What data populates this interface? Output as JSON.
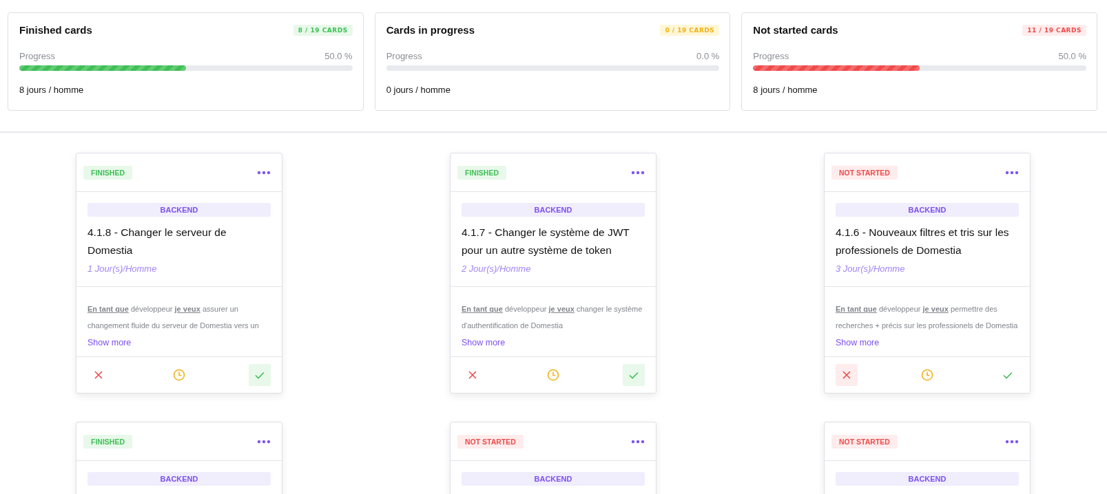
{
  "summary": [
    {
      "title": "Finished cards",
      "kind": "finished",
      "count": "8 / 19 CARDS",
      "progress_label": "Progress",
      "percent": "50.0 %",
      "level": 0.5,
      "effort": "8 jours / homme"
    },
    {
      "title": "Cards in progress",
      "kind": "in_progress",
      "count": "0 / 19 CARDS",
      "progress_label": "Progress",
      "percent": "0.0 %",
      "level": 0,
      "effort": "0 jours / homme"
    },
    {
      "title": "Not started cards",
      "kind": "not_started",
      "count": "11 / 19 CARDS",
      "progress_label": "Progress",
      "percent": "50.0 %",
      "level": 0.5,
      "effort": "8 jours / homme"
    }
  ],
  "cards": [
    {
      "kind": "finished",
      "status_label": "FINISHED",
      "tag": "BACKEND",
      "title": "4.1.8 - Changer le serveur de Domestia",
      "effort": "1 Jour(s)/Homme",
      "description": "**En tant que** développeur **je veux** assurer un changement fluide du serveur de Domestia vers un",
      "show_more": "Show more"
    },
    {
      "kind": "finished",
      "status_label": "FINISHED",
      "tag": "BACKEND",
      "title": "4.1.7 - Changer le système de JWT pour un autre système de token",
      "effort": "2 Jour(s)/Homme",
      "description": "**En tant que** développeur **je veux** changer le système d'authentification de Domestia",
      "show_more": "Show more"
    },
    {
      "kind": "not_started",
      "status_label": "NOT STARTED",
      "tag": "BACKEND",
      "title": "4.1.6 - Nouveaux filtres et tris sur les professionels de Domestia",
      "effort": "3 Jour(s)/Homme",
      "description": "**En tant que** développeur **je veux** permettre des recherches + précis sur les professionels de Domestia",
      "show_more": "Show more"
    },
    {
      "kind": "finished",
      "status_label": "FINISHED",
      "tag": "BACKEND"
    },
    {
      "kind": "not_started",
      "status_label": "NOT STARTED",
      "tag": "BACKEND"
    },
    {
      "kind": "not_started",
      "status_label": "NOT STARTED",
      "tag": "BACKEND"
    }
  ]
}
